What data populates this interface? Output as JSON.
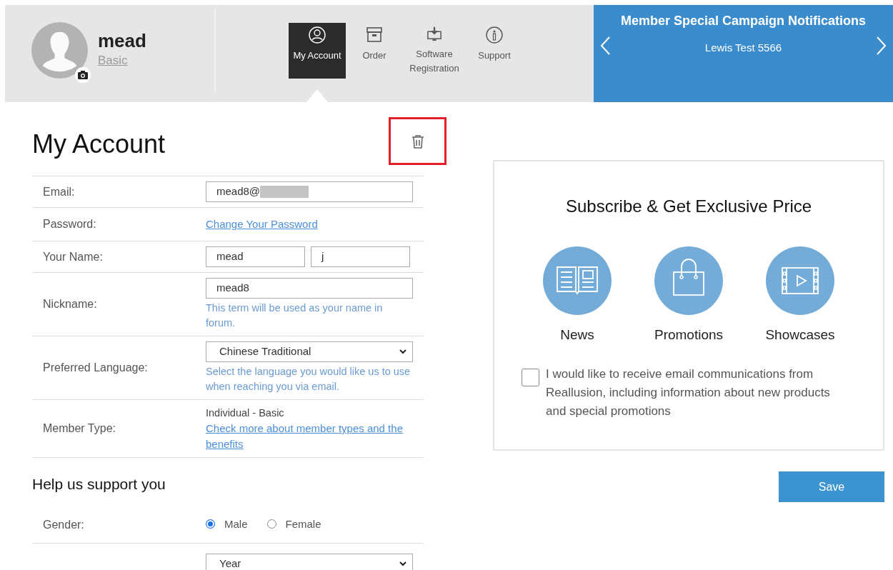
{
  "profile": {
    "name": "mead",
    "level": "Basic"
  },
  "nav": [
    {
      "label": "My Account",
      "kind": "person",
      "selected": true
    },
    {
      "label": "Order",
      "kind": "archive",
      "selected": false
    },
    {
      "label": "Software Registration",
      "kind": "download",
      "selected": false
    },
    {
      "label": "Support",
      "kind": "info",
      "selected": false
    }
  ],
  "campaign": {
    "title": "Member Special Campaign Notifications",
    "message": "Lewis Test 5566"
  },
  "page_title": "My Account",
  "delete_button": {
    "highlighted": true
  },
  "form_rows": [
    {
      "label": "Email:",
      "kind": "email",
      "value": "mead8@",
      "redacted": true
    },
    {
      "label": "Password:",
      "kind": "link",
      "link": "Change Your Password"
    },
    {
      "label": "Your Name:",
      "kind": "name",
      "first": "mead",
      "last": "j"
    },
    {
      "label": "Nickname:",
      "kind": "input",
      "value": "mead8",
      "hint": "This term will be used as your name in forum."
    },
    {
      "label": "Preferred Language:",
      "kind": "select",
      "value": "Chinese Traditional",
      "hint": "Select the language you would like us to use when reaching you via email."
    },
    {
      "label": "Member Type:",
      "kind": "info",
      "value": "Individual - Basic",
      "link": "Check more about member types and the benefits"
    }
  ],
  "support_title": "Help us support you",
  "gender": {
    "label": "Gender:",
    "options": [
      {
        "label": "Male",
        "selected": true
      },
      {
        "label": "Female",
        "selected": false
      }
    ]
  },
  "birth_year": {
    "value": "Year"
  },
  "subscribe": {
    "title": "Subscribe & Get Exclusive Price",
    "topics": [
      {
        "label": "News",
        "kind": "newspaper"
      },
      {
        "label": "Promotions",
        "kind": "bag"
      },
      {
        "label": "Showcases",
        "kind": "film"
      }
    ],
    "consent": {
      "text": "I would like to receive email communications from Reallusion, including information about new products and special promotions",
      "checked": false
    }
  },
  "save_label": "Save"
}
